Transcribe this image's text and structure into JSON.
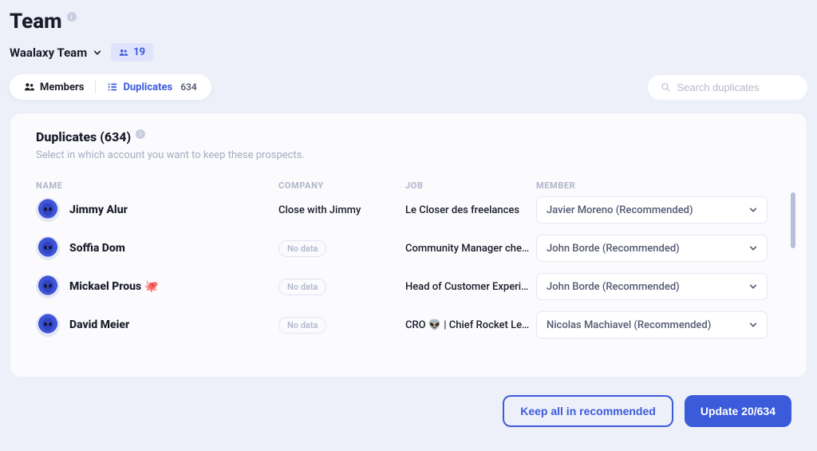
{
  "header": {
    "title": "Team",
    "team_name": "Waalaxy Team",
    "member_count": "19"
  },
  "tabs": {
    "members_label": "Members",
    "duplicates_label": "Duplicates",
    "duplicates_count": "634"
  },
  "search": {
    "placeholder": "Search duplicates"
  },
  "panel": {
    "title": "Duplicates (634)",
    "subtitle": "Select in which account you want to keep these prospects."
  },
  "columns": {
    "name": "NAME",
    "company": "COMPANY",
    "job": "JOB",
    "member": "MEMBER"
  },
  "no_data_label": "No data",
  "rows": [
    {
      "name": "Jimmy Alur",
      "emoji": "",
      "company": "Close with Jimmy",
      "job": "Le Closer des freelances",
      "member": "Javier Moreno (Recommended)"
    },
    {
      "name": "Soffia Dom",
      "emoji": "",
      "company": null,
      "job": "Community Manager chez…",
      "member": "John Borde (Recommended)"
    },
    {
      "name": "Mickael Prous",
      "emoji": "🐙",
      "company": null,
      "job": "Head of Customer Experie…",
      "member": "John Borde (Recommended)"
    },
    {
      "name": "David Meier",
      "emoji": "",
      "company": null,
      "job": "CRO 👽 | Chief Rocket Le…",
      "member": "Nicolas Machiavel (Recommended)"
    }
  ],
  "footer": {
    "keep_all": "Keep all in recommended",
    "update": "Update 20/634"
  }
}
